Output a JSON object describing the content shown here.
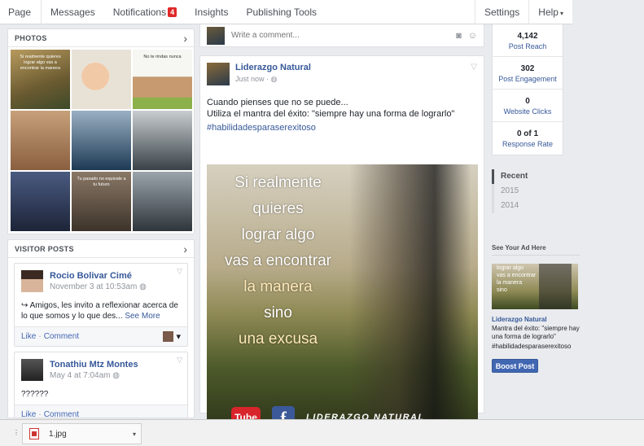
{
  "nav": {
    "page": "Page",
    "messages": "Messages",
    "notifications": "Notifications",
    "notifications_count": "4",
    "insights": "Insights",
    "publishing_tools": "Publishing Tools",
    "settings": "Settings",
    "help": "Help"
  },
  "photos": {
    "title": "PHOTOS",
    "tiles": [
      {
        "text": "Si realmente quieres lograr algo vas a encontrar la manera",
        "bg": "#7a6a3a"
      },
      {
        "text": "",
        "bg": "#e8e2d6"
      },
      {
        "text": "No te rindas nunca",
        "bg": "#f4f4f0"
      },
      {
        "text": "",
        "bg": "#a47c5a"
      },
      {
        "text": "",
        "bg": "#2d4a63"
      },
      {
        "text": "",
        "bg": "#6b7278"
      },
      {
        "text": "",
        "bg": "#2a3550"
      },
      {
        "text": "Tu pasado no equivale a tu futuro",
        "bg": "#6b5a4c"
      },
      {
        "text": "",
        "bg": "#556067"
      }
    ]
  },
  "visitor_posts": {
    "title": "VISITOR POSTS",
    "posts": [
      {
        "name": "Rocio Bolivar Cimé",
        "time": "November 3 at 10:53am",
        "text": "Amigos, les invito a reflexionar acerca de lo que somos y lo que des...",
        "see_more": "See More",
        "like": "Like",
        "comment": "Comment"
      },
      {
        "name": "Tonathiu Mtz Montes",
        "time": "May 4 at 7:04am",
        "text": "??????",
        "like": "Like",
        "comment": "Comment"
      }
    ]
  },
  "composer": {
    "placeholder": "Write a comment..."
  },
  "post": {
    "author": "Liderazgo Natural",
    "time": "Just now",
    "text_line1": "Cuando pienses que no se puede...",
    "text_line2": "Utiliza el mantra del éxito: \"siempre hay una forma de lograrlo\"",
    "hashtag": "#habilidadesparaserexitoso",
    "image_lines": [
      "Si realmente",
      "quieres",
      "lograr algo",
      "vas a encontrar",
      "la manera",
      "sino",
      "una excusa"
    ],
    "image_logo_tube": "Tube",
    "image_logo_f": "f",
    "image_brand": "LIDERAZGO NATURAL"
  },
  "stats": [
    {
      "value": "4,142",
      "label": "Post Reach"
    },
    {
      "value": "302",
      "label": "Post Engagement"
    },
    {
      "value": "0",
      "label": "Website Clicks"
    },
    {
      "value": "0 of 1",
      "label": "Response Rate"
    }
  ],
  "timeline": {
    "items": [
      "Recent",
      "2015",
      "2014"
    ]
  },
  "ad": {
    "heading": "See Your Ad Here",
    "img_lines": [
      "lograr algo",
      "vas a encontrar",
      "la manera",
      "sino"
    ],
    "name": "Liderazgo Natural",
    "text": "Mantra del éxito: \"siempre hay una forma de lograrlo\"",
    "hashtag": "#habilidadesparaserexitoso",
    "boost": "Boost Post"
  },
  "download_bar": {
    "file_name": "1.jpg"
  },
  "colors": {
    "brand_blue": "#365899",
    "button_blue": "#4267b2",
    "badge_red": "#e02727"
  }
}
